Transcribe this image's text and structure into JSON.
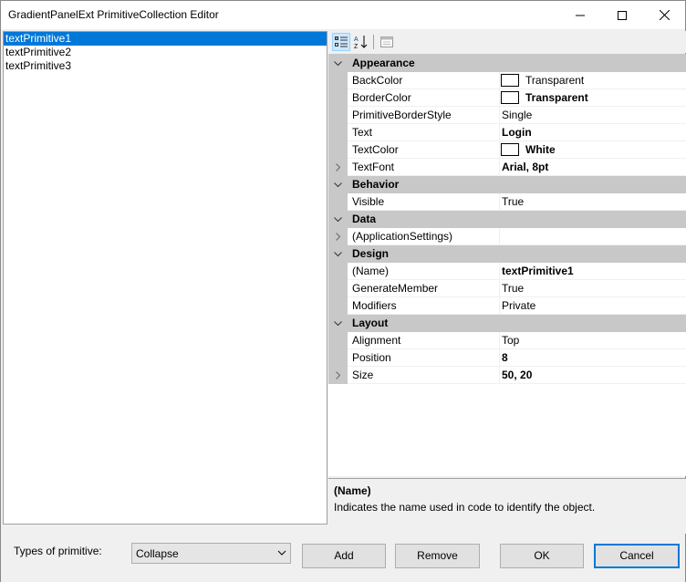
{
  "window": {
    "title": "GradientPanelExt PrimitiveCollection Editor"
  },
  "list": {
    "items": [
      "textPrimitive1",
      "textPrimitive2",
      "textPrimitive3"
    ],
    "selected_index": 0
  },
  "toolbar": {
    "categorized_icon": "categorized-icon",
    "alphabetical_icon": "alphabetical-icon",
    "property_pages_icon": "property-pages-icon"
  },
  "grid": {
    "appearance": {
      "label": "Appearance",
      "backcolor": {
        "name": "BackColor",
        "value": "Transparent"
      },
      "bordercolor": {
        "name": "BorderColor",
        "value": "Transparent"
      },
      "primitiveborderstyle": {
        "name": "PrimitiveBorderStyle",
        "value": "Single"
      },
      "text": {
        "name": "Text",
        "value": "Login"
      },
      "textcolor": {
        "name": "TextColor",
        "value": "White"
      },
      "textfont": {
        "name": "TextFont",
        "value": "Arial, 8pt"
      }
    },
    "behavior": {
      "label": "Behavior",
      "visible": {
        "name": "Visible",
        "value": "True"
      }
    },
    "data": {
      "label": "Data",
      "appsettings": {
        "name": "(ApplicationSettings)",
        "value": ""
      }
    },
    "design": {
      "label": "Design",
      "name": {
        "name": "(Name)",
        "value": "textPrimitive1"
      },
      "generatemember": {
        "name": "GenerateMember",
        "value": "True"
      },
      "modifiers": {
        "name": "Modifiers",
        "value": "Private"
      }
    },
    "layout": {
      "label": "Layout",
      "alignment": {
        "name": "Alignment",
        "value": "Top"
      },
      "position": {
        "name": "Position",
        "value": "8"
      },
      "size": {
        "name": "Size",
        "value": "50, 20"
      }
    }
  },
  "help": {
    "title": "(Name)",
    "description": "Indicates the name used in code to identify the object."
  },
  "bottom": {
    "types_label": "Types of primitive:",
    "combo_value": "Collapse",
    "add": "Add",
    "remove": "Remove",
    "ok": "OK",
    "cancel": "Cancel"
  },
  "colors": {
    "selection": "#0078d7",
    "category_bg": "#c8c8c8",
    "window_bg": "#f0f0f0"
  }
}
